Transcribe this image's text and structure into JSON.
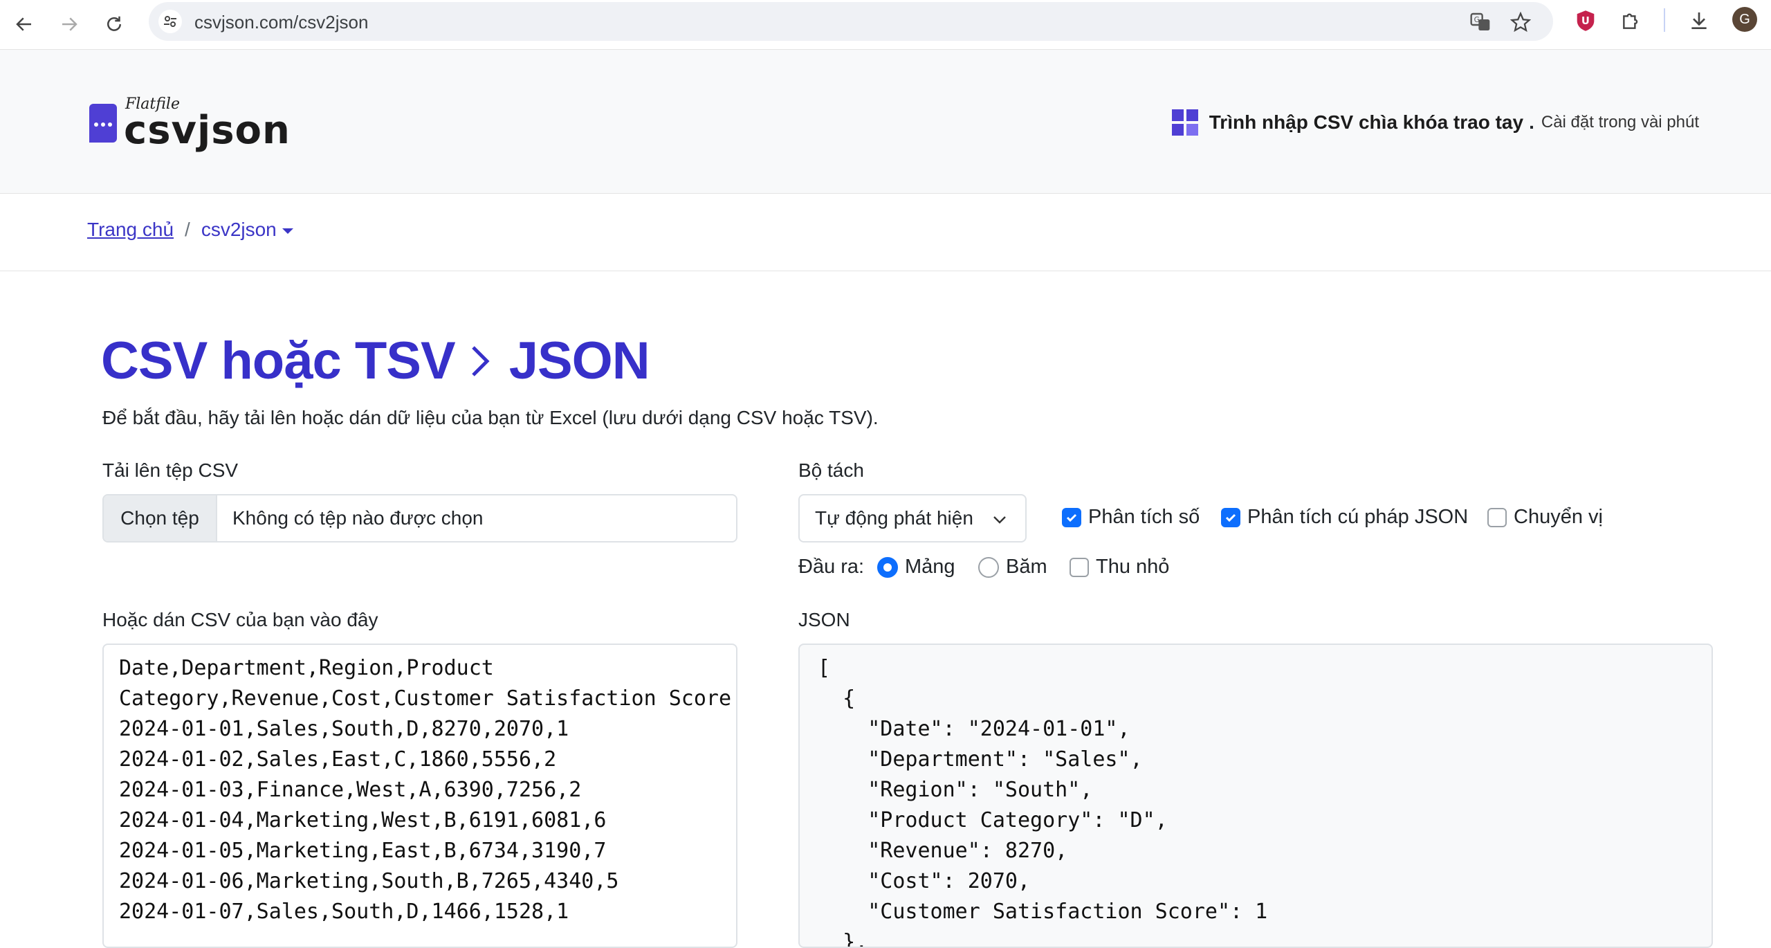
{
  "browser": {
    "url": "csvjson.com/csv2json",
    "avatar_letter": "G"
  },
  "header": {
    "logo_small": "Flatfile",
    "logo_brand": "csvjson",
    "promo_strong": "Trình nhập CSV chìa khóa trao tay",
    "promo_dot": ".",
    "promo_light": "Cài đặt trong vài phút"
  },
  "breadcrumb": {
    "home": "Trang chủ",
    "separator": "/",
    "current": "csv2json"
  },
  "main": {
    "title_left": "CSV hoặc TSV",
    "title_right": "JSON",
    "lead": "Để bắt đầu, hãy tải lên hoặc dán dữ liệu của bạn từ Excel (lưu dưới dạng CSV hoặc TSV).",
    "upload_label": "Tải lên tệp CSV",
    "file_button": "Chọn tệp",
    "file_status": "Không có tệp nào được chọn",
    "separator_label": "Bộ tách",
    "separator_value": "Tự động phát hiện",
    "options": {
      "parse_numbers": {
        "label": "Phân tích số",
        "checked": true
      },
      "parse_json": {
        "label": "Phân tích cú pháp JSON",
        "checked": true
      },
      "transpose": {
        "label": "Chuyển vị",
        "checked": false
      }
    },
    "output_label": "Đầu ra:",
    "output": {
      "array": {
        "label": "Mảng",
        "selected": true
      },
      "hash": {
        "label": "Băm",
        "selected": false
      },
      "minify": {
        "label": "Thu nhỏ",
        "checked": false
      }
    },
    "paste_label": "Hoặc dán CSV của bạn vào đây",
    "csv_text": "Date,Department,Region,Product\nCategory,Revenue,Cost,Customer Satisfaction Score\n2024-01-01,Sales,South,D,8270,2070,1\n2024-01-02,Sales,East,C,1860,5556,2\n2024-01-03,Finance,West,A,6390,7256,2\n2024-01-04,Marketing,West,B,6191,6081,6\n2024-01-05,Marketing,East,B,6734,3190,7\n2024-01-06,Marketing,South,B,7265,4340,5\n2024-01-07,Sales,South,D,1466,1528,1",
    "json_label": "JSON",
    "json_text": "[\n  {\n    \"Date\": \"2024-01-01\",\n    \"Department\": \"Sales\",\n    \"Region\": \"South\",\n    \"Product Category\": \"D\",\n    \"Revenue\": 8270,\n    \"Cost\": 2070,\n    \"Customer Satisfaction Score\": 1\n  },"
  },
  "colors": {
    "brand_purple": "#3730c9",
    "link_blue": "#3b35c6",
    "check_blue": "#0d6efd"
  }
}
